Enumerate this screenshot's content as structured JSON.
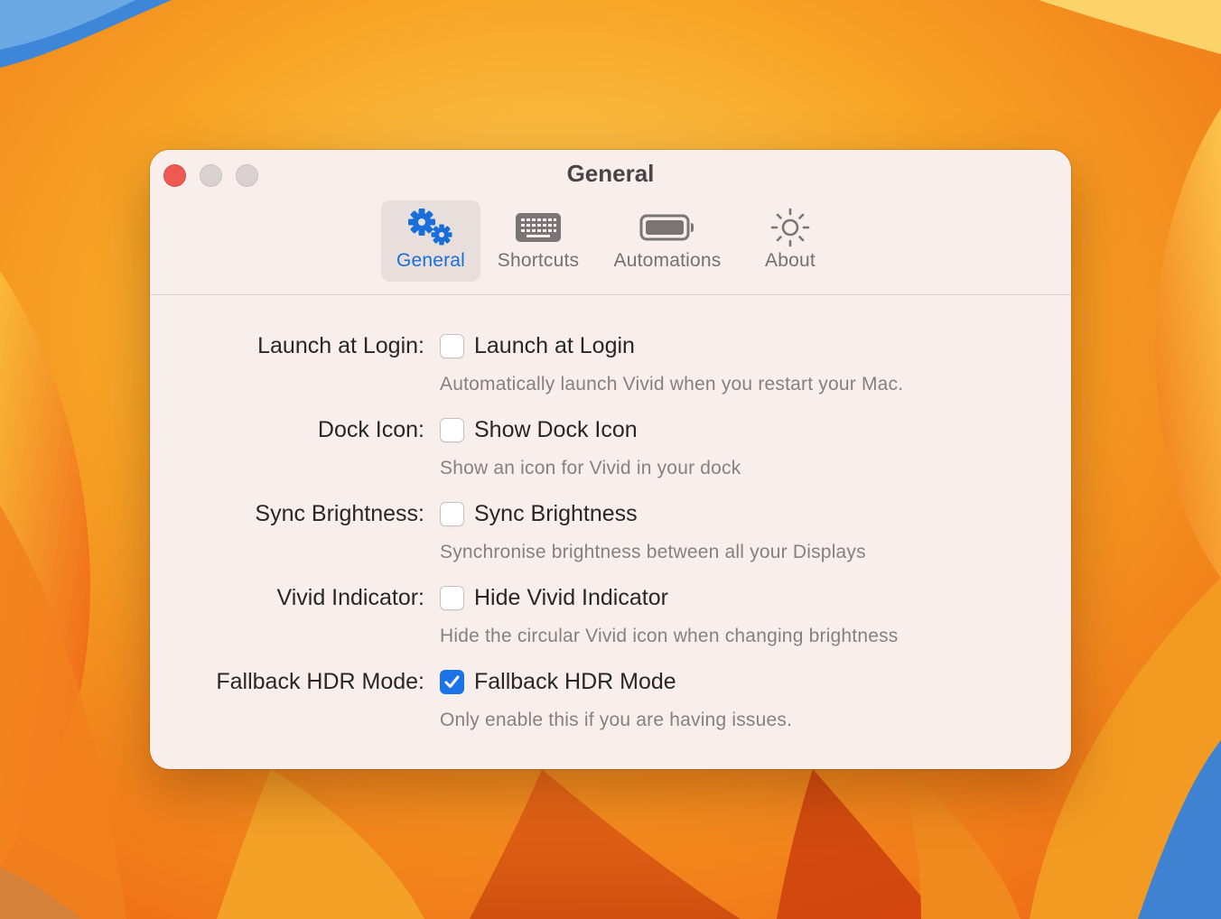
{
  "window": {
    "title": "General"
  },
  "toolbar": {
    "tabs": [
      {
        "label": "General",
        "icon": "gears-icon",
        "selected": true
      },
      {
        "label": "Shortcuts",
        "icon": "keyboard-icon",
        "selected": false
      },
      {
        "label": "Automations",
        "icon": "battery-icon",
        "selected": false
      },
      {
        "label": "About",
        "icon": "sun-icon",
        "selected": false
      }
    ]
  },
  "settings": [
    {
      "label": "Launch at Login:",
      "checkbox_label": "Launch at Login",
      "description": "Automatically launch Vivid when you restart your Mac.",
      "checked": false
    },
    {
      "label": "Dock Icon:",
      "checkbox_label": "Show Dock Icon",
      "description": "Show an icon for Vivid in your dock",
      "checked": false
    },
    {
      "label": "Sync Brightness:",
      "checkbox_label": "Sync Brightness",
      "description": "Synchronise brightness between all your Displays",
      "checked": false
    },
    {
      "label": "Vivid Indicator:",
      "checkbox_label": "Hide Vivid Indicator",
      "description": "Hide the circular Vivid icon when changing brightness",
      "checked": false
    },
    {
      "label": "Fallback HDR Mode:",
      "checkbox_label": "Fallback HDR Mode",
      "description": "Only enable this if you are having issues.",
      "checked": true
    }
  ],
  "colors": {
    "accent": "#1a74e8",
    "close_button": "#ee5a52",
    "window_background": "#f8eeec"
  }
}
